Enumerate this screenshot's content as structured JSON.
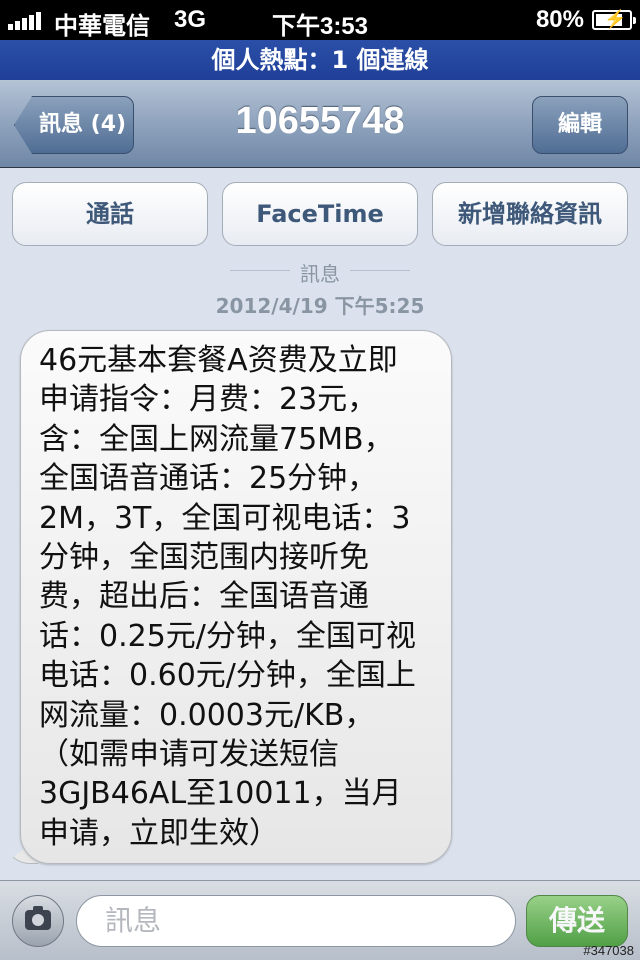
{
  "status_bar": {
    "carrier": "中華電信",
    "network": "3G",
    "time": "下午3:53",
    "battery": "80%"
  },
  "hotspot": {
    "text": "個人熱點：1 個連線"
  },
  "nav": {
    "back_label": "訊息 (4)",
    "title": "10655748",
    "edit_label": "編輯"
  },
  "actions": {
    "call": "通話",
    "facetime": "FaceTime",
    "add_contact": "新增聯絡資訊"
  },
  "timestamp": {
    "label": "訊息",
    "date": "2012/4/19 下午5:25"
  },
  "message": {
    "text": "46元基本套餐A资费及立即\n申请指令：月费：23元，\n含：全国上网流量75MB，\n全国语音通话：25分钟，\n2M，3T，全国可视电话：3\n分钟，全国范围内接听免\n费，超出后：全国语音通\n话：0.25元/分钟，全国可视\n电话：0.60元/分钟，全国上\n网流量：0.0003元/KB，\n（如需申请可发送短信\n3GJB46AL至10011，当月\n申请，立即生效）"
  },
  "input": {
    "placeholder": "訊息",
    "send_label": "傳送"
  },
  "watermark": "#347038",
  "colors": {
    "hotspot_blue": "#1f3f98",
    "send_green": "#3e9a2f",
    "background": "#dbe2ed"
  }
}
